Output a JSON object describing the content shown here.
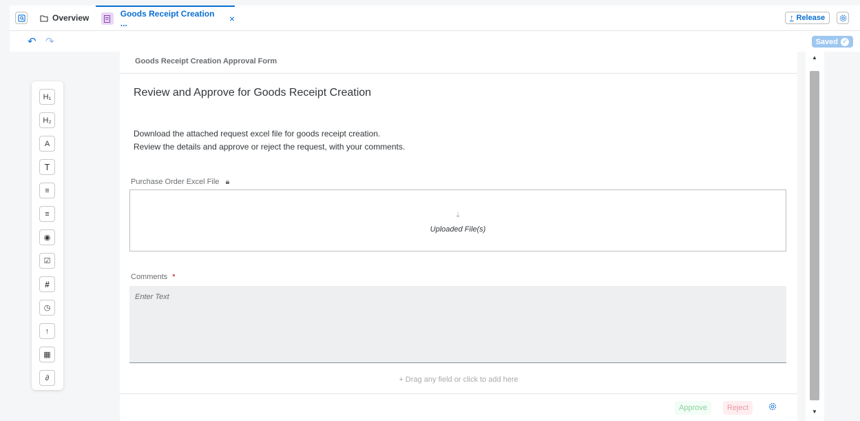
{
  "topbar": {
    "overview_label": "Overview",
    "active_tab_label": "Goods Receipt Creation ...",
    "close_glyph": "×",
    "release_label": "Release"
  },
  "toolbar": {
    "saved_label": "Saved"
  },
  "palette": {
    "items": [
      "H₁",
      "H₂",
      "A",
      "T",
      "≡",
      "≡",
      "◉",
      "☑",
      "#",
      "◷",
      "↑",
      "▦",
      "∂"
    ]
  },
  "form": {
    "title": "Goods Receipt Creation Approval Form",
    "heading": "Review and Approve for Goods Receipt Creation",
    "paragraph_line1": "Download the attached request excel file for goods receipt creation.",
    "paragraph_line2": "Review the details and approve or reject the request, with your comments.",
    "upload_label": "Purchase Order Excel File",
    "upload_text": "Uploaded File(s)",
    "comments_label": "Comments",
    "required_mark": "*",
    "comments_placeholder": "Enter Text",
    "drag_text": "+ Drag any field or click to add here",
    "approve_label": "Approve",
    "reject_label": "Reject"
  },
  "colors": {
    "accent": "#0a6ed1",
    "approve_bg": "#f1fdf6",
    "approve_text": "#8fcf9f",
    "reject_bg": "#ffeef0",
    "reject_text": "#e69aa6"
  }
}
